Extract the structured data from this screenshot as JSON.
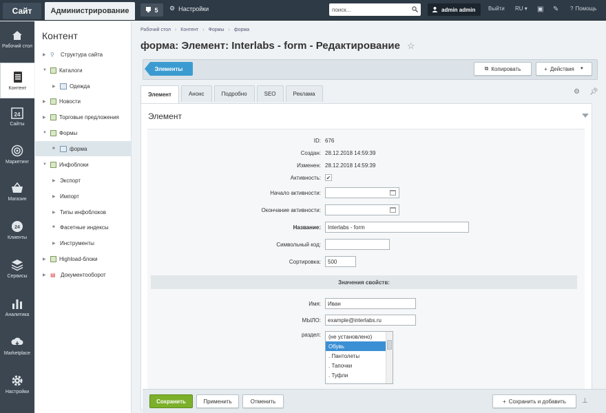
{
  "topbar": {
    "site_label": "Сайт",
    "admin_label": "Администрирование",
    "notifications_count": "5",
    "settings_label": "Настройки",
    "search_placeholder": "поиск...",
    "user_label": "admin admin",
    "logout_label": "Выйти",
    "lang_label": "RU",
    "help_label": "Помощь"
  },
  "leftbar": {
    "items": [
      {
        "label": "Рабочий стол",
        "icon": "home-icon"
      },
      {
        "label": "Контент",
        "icon": "document-icon"
      },
      {
        "label": "Сайты",
        "icon": "calendar-24-icon"
      },
      {
        "label": "Маркетинг",
        "icon": "target-icon"
      },
      {
        "label": "Магазин",
        "icon": "basket-icon"
      },
      {
        "label": "Клиенты",
        "icon": "clients-24-icon"
      },
      {
        "label": "Сервисы",
        "icon": "layers-icon"
      },
      {
        "label": "Аналитика",
        "icon": "bar-chart-icon"
      },
      {
        "label": "Marketplace",
        "icon": "cloud-download-icon"
      },
      {
        "label": "Настройки",
        "icon": "gear-icon"
      }
    ]
  },
  "menu": {
    "title": "Контент",
    "items": [
      {
        "label": "Структура сайта"
      },
      {
        "label": "Каталоги"
      },
      {
        "label": "Одежда"
      },
      {
        "label": "Новости"
      },
      {
        "label": "Торговые предложения"
      },
      {
        "label": "Формы"
      },
      {
        "label": "форма"
      },
      {
        "label": "Инфоблоки"
      },
      {
        "label": "Экспорт"
      },
      {
        "label": "Импорт"
      },
      {
        "label": "Типы инфоблоков"
      },
      {
        "label": "Фасетные индексы"
      },
      {
        "label": "Инструменты"
      },
      {
        "label": "Highload-блоки"
      },
      {
        "label": "Документооборот"
      }
    ]
  },
  "breadcrumb": [
    "Рабочий стол",
    "Контент",
    "Формы",
    "форма"
  ],
  "page_title": "форма: Элемент: Interlabs - form - Редактирование",
  "toolbar": {
    "elements_label": "Элементы",
    "copy_label": "Копировать",
    "actions_label": "Действия"
  },
  "tabs": [
    "Элемент",
    "Анонс",
    "Подробно",
    "SEO",
    "Реклама"
  ],
  "panel": {
    "heading": "Элемент",
    "id_label": "ID:",
    "id_value": "676",
    "created_label": "Создан:",
    "created_value": "28.12.2018 14:59:39",
    "modified_label": "Изменен:",
    "modified_value": "28.12.2018 14:59:39",
    "active_label": "Активность:",
    "active_from_label": "Начало активности:",
    "active_to_label": "Окончание активности:",
    "name_label": "Название:",
    "name_value": "Interlabs - form",
    "code_label": "Символьный код:",
    "sort_label": "Сортировка:",
    "sort_value": "500",
    "props_section": "Значения свойств:",
    "prop_name_label": "Имя:",
    "prop_name_value": "Иван",
    "prop_email_label": "МЫЛО:",
    "prop_email_value": "example@interlabs.ru",
    "prop_section_label": "раздел:",
    "section_options": [
      "(не установлено)",
      "Обувь",
      ". Пантолеты",
      ". Тапочки",
      ". Туфли"
    ],
    "selected_option": "Обувь"
  },
  "bottom": {
    "save_label": "Сохранить",
    "apply_label": "Применить",
    "cancel_label": "Отменить",
    "save_add_label": "Сохранить и добавить"
  },
  "colors": {
    "topbar": "#2e3a46",
    "leftbar": "#3c4651",
    "accent_blue": "#3b9bd1",
    "save_green": "#7cb02a"
  }
}
